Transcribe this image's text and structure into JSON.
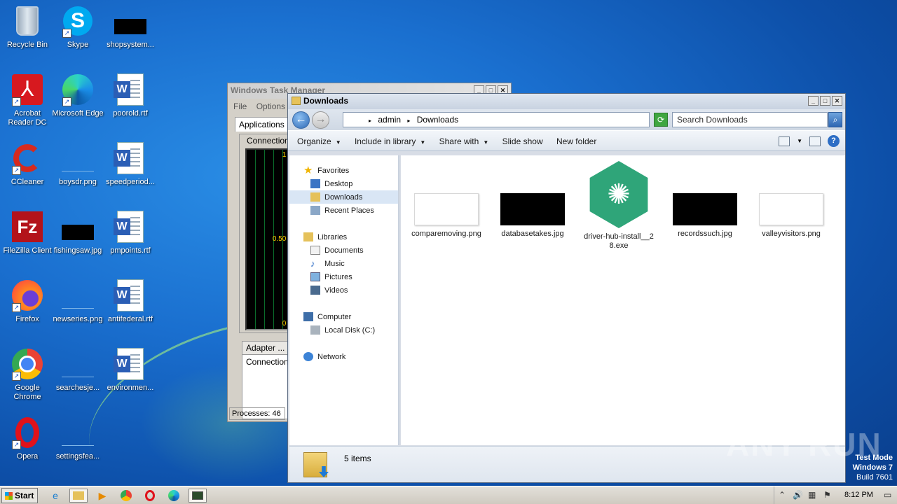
{
  "desktop": {
    "icons": [
      {
        "label": "Recycle Bin",
        "icon": "recycle-bin-icon"
      },
      {
        "label": "Skype",
        "icon": "skype-icon"
      },
      {
        "label": "shopsystem...",
        "icon": "image-thumbnail-icon"
      },
      {
        "label": "Acrobat Reader DC",
        "icon": "acrobat-icon"
      },
      {
        "label": "Microsoft Edge",
        "icon": "edge-icon"
      },
      {
        "label": "poorold.rtf",
        "icon": "word-document-icon"
      },
      {
        "label": "CCleaner",
        "icon": "ccleaner-icon"
      },
      {
        "label": "boysdr.png",
        "icon": "image-thumbnail-icon"
      },
      {
        "label": "speedperiod...",
        "icon": "word-document-icon"
      },
      {
        "label": "FileZilla Client",
        "icon": "filezilla-icon"
      },
      {
        "label": "fishingsaw.jpg",
        "icon": "image-thumbnail-icon"
      },
      {
        "label": "pmpoints.rtf",
        "icon": "word-document-icon"
      },
      {
        "label": "Firefox",
        "icon": "firefox-icon"
      },
      {
        "label": "newseries.png",
        "icon": "image-thumbnail-icon"
      },
      {
        "label": "antifederal.rtf",
        "icon": "word-document-icon"
      },
      {
        "label": "Google Chrome",
        "icon": "chrome-icon"
      },
      {
        "label": "searchesje...",
        "icon": "image-thumbnail-icon"
      },
      {
        "label": "environmen...",
        "icon": "word-document-icon"
      },
      {
        "label": "Opera",
        "icon": "opera-icon"
      },
      {
        "label": "settingsfea...",
        "icon": "image-thumbnail-icon"
      }
    ]
  },
  "task_manager": {
    "title": "Windows Task Manager",
    "menu": [
      "File",
      "Options"
    ],
    "tab": "Applications",
    "connection_header": "Connection",
    "graph_labels": [
      "1 %",
      "0.50 %",
      "0 %"
    ],
    "adapter_header": "Adapter ...",
    "adapter_row": "Connection",
    "status": "Processes: 46"
  },
  "explorer": {
    "title": "Downloads",
    "breadcrumb": [
      "admin",
      "Downloads"
    ],
    "search_placeholder": "Search Downloads",
    "commands": [
      "Organize",
      "Include in library",
      "Share with",
      "Slide show",
      "New folder"
    ],
    "nav": {
      "favorites": "Favorites",
      "favorites_items": [
        "Desktop",
        "Downloads",
        "Recent Places"
      ],
      "libraries": "Libraries",
      "libraries_items": [
        "Documents",
        "Music",
        "Pictures",
        "Videos"
      ],
      "computer": "Computer",
      "computer_items": [
        "Local Disk (C:)"
      ],
      "network": "Network"
    },
    "files": [
      {
        "name": "comparemoving.png",
        "thumb": "white"
      },
      {
        "name": "databasetakes.jpg",
        "thumb": "black"
      },
      {
        "name": "driver-hub-install__28.exe",
        "thumb": "hex-app"
      },
      {
        "name": "recordssuch.jpg",
        "thumb": "black"
      },
      {
        "name": "valleyvisitors.png",
        "thumb": "white"
      }
    ],
    "item_count": "5 items"
  },
  "watermark": {
    "text": "ANY RUN"
  },
  "test_mode": {
    "line1": "Test Mode",
    "line2": "Windows 7",
    "line3": "Build 7601"
  },
  "taskbar": {
    "start": "Start",
    "clock": "8:12 PM"
  }
}
